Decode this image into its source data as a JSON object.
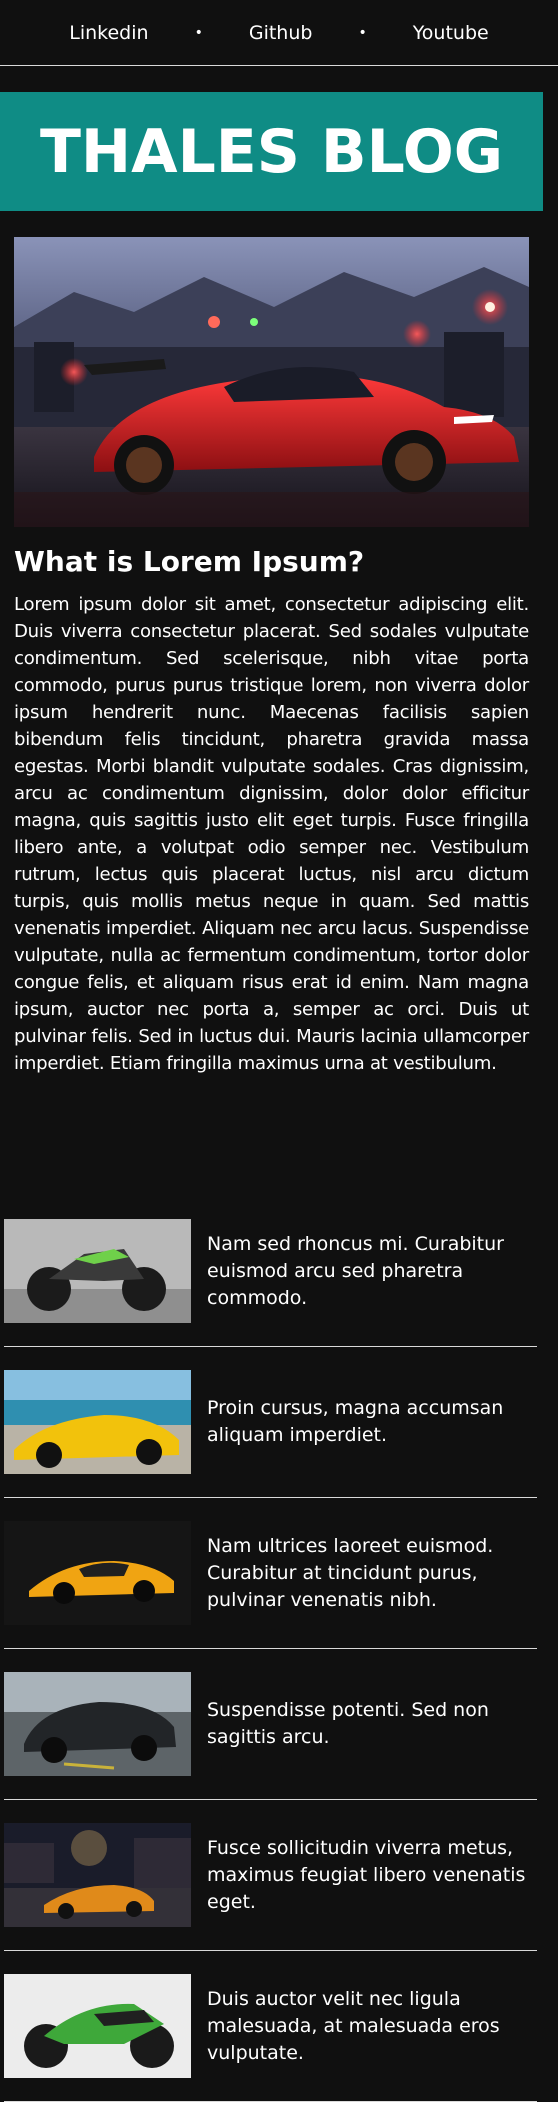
{
  "nav": {
    "links": [
      "Linkedin",
      "Github",
      "Youtube"
    ],
    "separator": "•"
  },
  "banner": {
    "title": "THALES BLOG",
    "color": "#0f8c85"
  },
  "article": {
    "heading": "What is Lorem Ipsum?",
    "body": "Lorem ipsum dolor sit amet, consectetur adipiscing elit. Duis viverra consectetur placerat. Sed sodales vulputate condimentum. Sed scelerisque, nibh vitae porta commodo, purus purus tristique lorem, non viverra dolor ipsum hendrerit nunc. Maecenas facilisis sapien bibendum felis tincidunt, pharetra gravida massa egestas. Morbi blandit vulputate sodales. Cras dignissim, arcu ac condimentum dignissim, dolor dolor efficitur magna, quis sagittis justo elit eget turpis. Fusce fringilla libero ante, a volutpat odio semper nec. Vestibulum rutrum, lectus quis placerat luctus, nisl arcu dictum turpis, quis mollis metus neque in quam. Sed mattis venenatis imperdiet. Aliquam nec arcu lacus. Suspendisse vulputate, nulla ac fermentum condimentum, tortor dolor congue felis, et aliquam risus erat id enim. Nam magna ipsum, auctor nec porta a, semper ac orci. Duis ut pulvinar felis. Sed in luctus dui. Mauris lacinia ullamcorper imperdiet. Etiam fringilla maximus urna at vestibulum."
  },
  "cards": [
    {
      "text": "Nam sed rhoncus mi. Curabitur euismod arcu sed pharetra commodo.",
      "image": "grey-motorcycle"
    },
    {
      "text": "Proin cursus, magna accumsan aliquam imperdiet.",
      "image": "yellow-sports-car-beach"
    },
    {
      "text": "Nam ultrices laoreet euismod. Curabitur at tincidunt purus, pulvinar venenatis nibh.",
      "image": "yellow-supercar-dark"
    },
    {
      "text": "Suspendisse potenti. Sed non sagittis arcu.",
      "image": "black-suv-wet-road"
    },
    {
      "text": "Fusce sollicitudin viverra metus, maximus feugiat libero venenatis eget.",
      "image": "orange-car-city-night"
    },
    {
      "text": "Duis auctor velit nec ligula malesuada, at malesuada eros vulputate.",
      "image": "green-sport-motorcycle"
    }
  ]
}
